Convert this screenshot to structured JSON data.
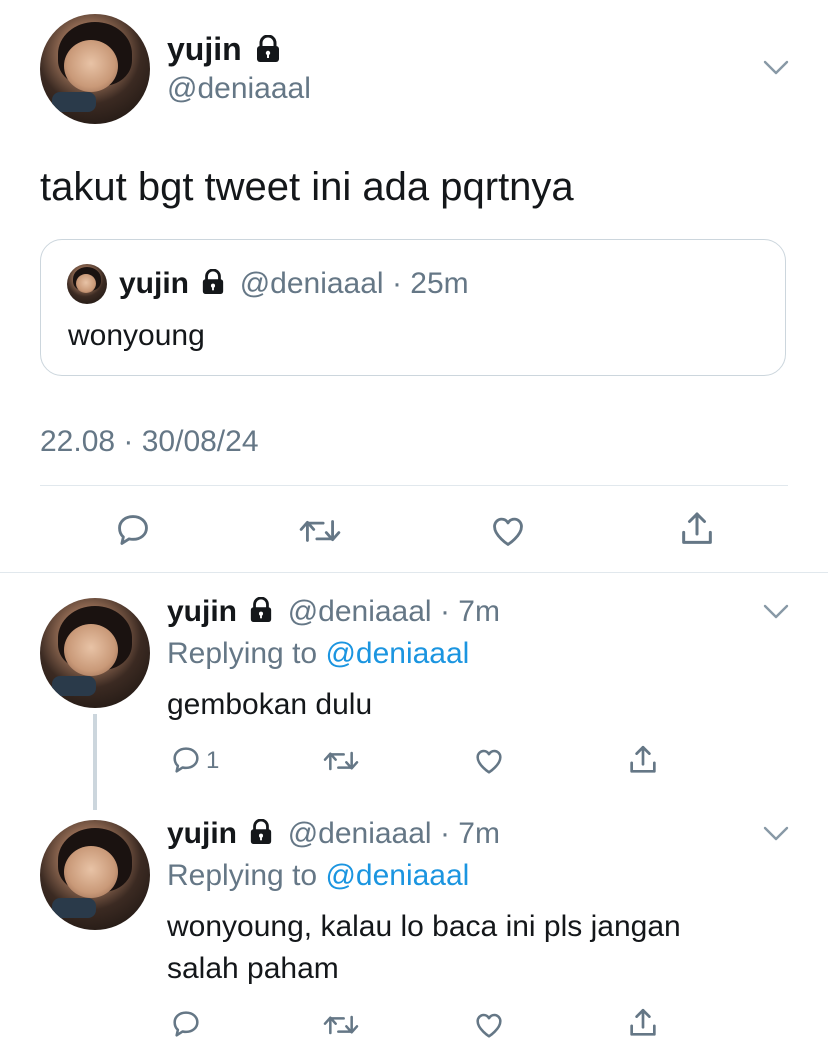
{
  "main_tweet": {
    "name": "yujin",
    "handle": "@deniaaal",
    "text": "takut bgt tweet ini ada pqrtnya",
    "quote": {
      "name": "yujin",
      "handle": "@deniaaal",
      "separator": "·",
      "time": "25m",
      "text": "wonyoung"
    },
    "timestamp": "22.08 · 30/08/24"
  },
  "replies": [
    {
      "name": "yujin",
      "handle": "@deniaaal",
      "separator": "·",
      "time": "7m",
      "replying_prefix": "Replying to",
      "replying_to": "@deniaaal",
      "text": "gembokan dulu",
      "reply_count": "1"
    },
    {
      "name": "yujin",
      "handle": "@deniaaal",
      "separator": "·",
      "time": "7m",
      "replying_prefix": "Replying to",
      "replying_to": "@deniaaal",
      "text_line1": "wonyoung, kalau lo baca ini pls jangan",
      "text_line2": "salah paham",
      "reply_count": ""
    }
  ],
  "icons": {
    "lock": "lock-icon",
    "chevron": "chevron-down-icon",
    "reply": "reply-icon",
    "retweet": "retweet-icon",
    "like": "heart-icon",
    "share": "share-icon"
  },
  "colors": {
    "text": "#14171a",
    "muted": "#657786",
    "link": "#1b95e0",
    "divider": "#e1e8ed"
  }
}
